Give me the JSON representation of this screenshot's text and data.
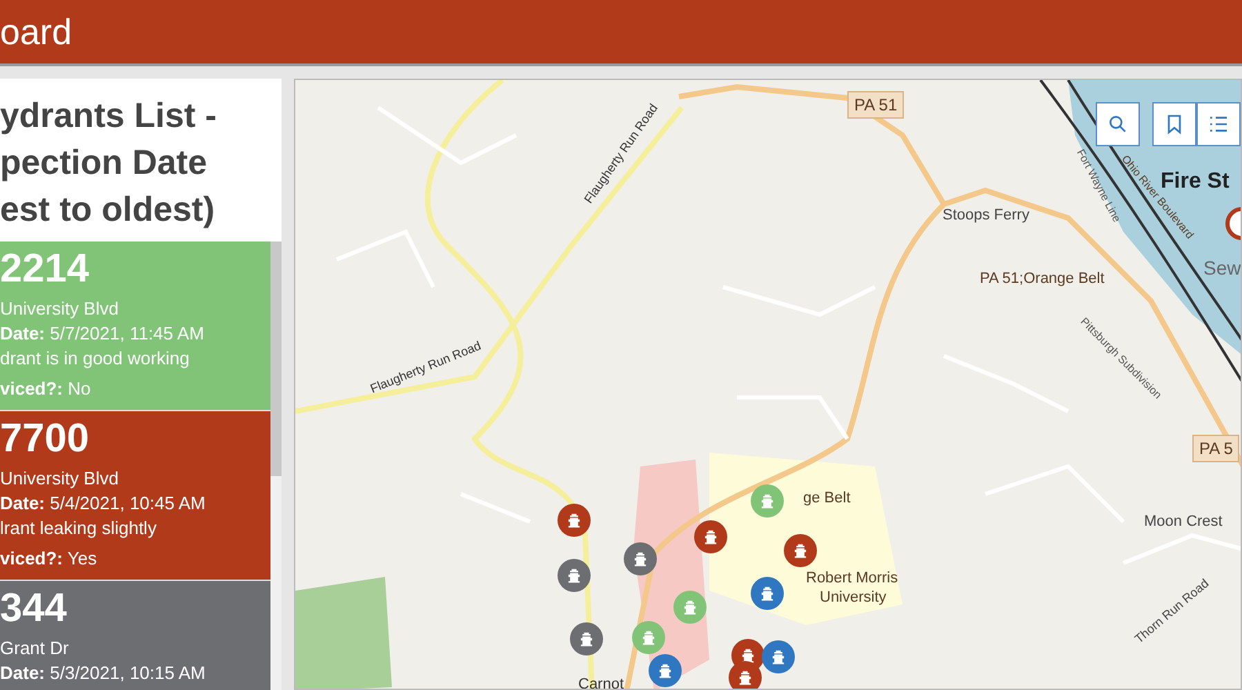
{
  "header": {
    "title": "oard"
  },
  "list_panel": {
    "title_lines": [
      "ydrants List -",
      "pection Date",
      "est to oldest)"
    ],
    "cards": [
      {
        "number": "2214",
        "street": "University Blvd",
        "date": "**Date:** 5/7/2021, 11:45 AM",
        "note": "drant is in good working",
        "serviced": "**viced?:** No",
        "color": "#82c477"
      },
      {
        "number": "7700",
        "street": "University Blvd",
        "date": "**Date:** 5/4/2021, 10:45 AM",
        "note": "lrant leaking slightly",
        "serviced": "**viced?:** Yes",
        "color": "#b03a1a"
      },
      {
        "number": "344",
        "street": "Grant Dr",
        "date": "**Date:** 5/3/2021, 10:15 AM",
        "color": "#6d6e71"
      }
    ]
  },
  "map": {
    "labels": [
      "PA 51",
      "Flaugherty Run Road",
      "Flaugherty Run Road",
      "Stoops Ferry",
      "PA 51;Orange Belt",
      "Fire St",
      "Sew",
      "Ohio River Boulevard",
      "Fort Wayne Line",
      "Pittsburgh Subdivision",
      "PA 5",
      "Moon Crest",
      "Thorn Run Road",
      "ge Belt",
      "Robert Morris",
      "University",
      "Carnot"
    ],
    "markers": [
      {
        "color": "#b03a1a"
      },
      {
        "color": "#6d6e71"
      },
      {
        "color": "#6d6e71"
      },
      {
        "color": "#b03a1a"
      },
      {
        "color": "#82c477"
      },
      {
        "color": "#b03a1a"
      },
      {
        "color": "#2f77c0"
      },
      {
        "color": "#82c477"
      },
      {
        "color": "#6d6e71"
      },
      {
        "color": "#82c477"
      },
      {
        "color": "#2f77c0"
      },
      {
        "color": "#b03a1a"
      },
      {
        "color": "#2f77c0"
      },
      {
        "color": "#b03a1a"
      }
    ]
  }
}
